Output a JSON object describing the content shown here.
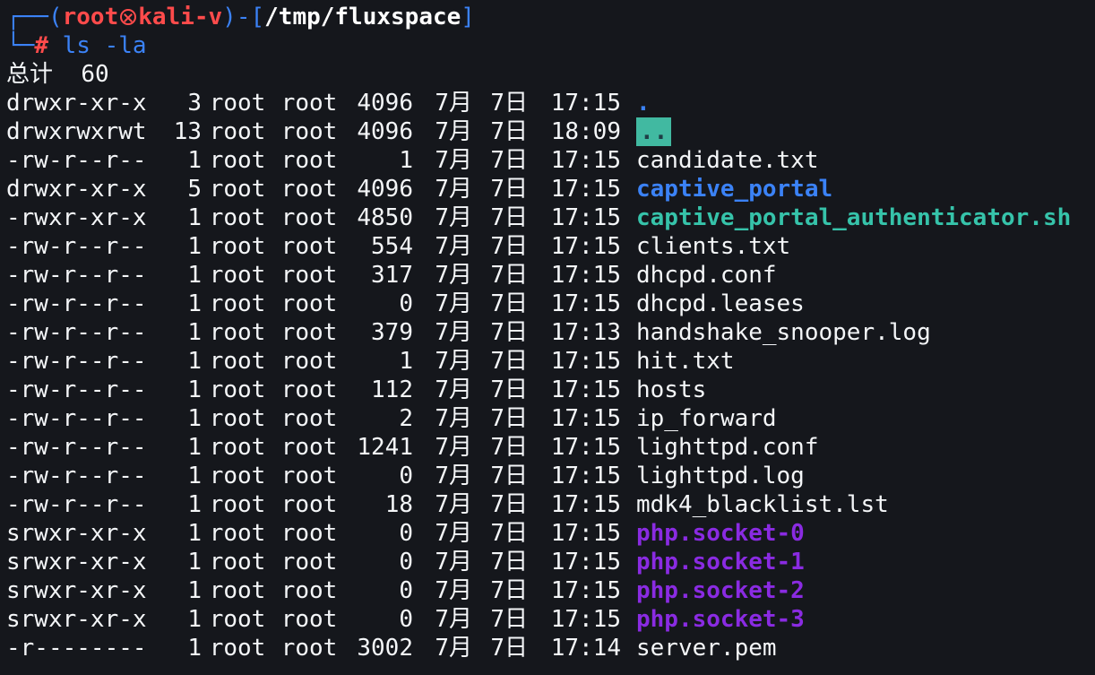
{
  "prompt": {
    "open": "┌──(",
    "user": "root",
    "host": "kali-v",
    "mid": ")-[",
    "path": "/tmp/fluxspace",
    "close": "]",
    "second_prefix": "└─",
    "hash": "#",
    "command": "ls -la"
  },
  "total": {
    "label": "总计",
    "value": "60"
  },
  "entries": [
    {
      "perm": "drwxr-xr-x",
      "links": "3",
      "owner": "root",
      "group": "root",
      "size": "4096",
      "month": "7月",
      "day": "7日",
      "time": "17:15",
      "name": "."
    },
    {
      "perm": "drwxrwxrwt",
      "links": "13",
      "owner": "root",
      "group": "root",
      "size": "4096",
      "month": "7月",
      "day": "7日",
      "time": "18:09",
      "name": ".."
    },
    {
      "perm": "-rw-r--r--",
      "links": "1",
      "owner": "root",
      "group": "root",
      "size": "1",
      "month": "7月",
      "day": "7日",
      "time": "17:15",
      "name": "candidate.txt"
    },
    {
      "perm": "drwxr-xr-x",
      "links": "5",
      "owner": "root",
      "group": "root",
      "size": "4096",
      "month": "7月",
      "day": "7日",
      "time": "17:15",
      "name": "captive_portal"
    },
    {
      "perm": "-rwxr-xr-x",
      "links": "1",
      "owner": "root",
      "group": "root",
      "size": "4850",
      "month": "7月",
      "day": "7日",
      "time": "17:15",
      "name": "captive_portal_authenticator.sh"
    },
    {
      "perm": "-rw-r--r--",
      "links": "1",
      "owner": "root",
      "group": "root",
      "size": "554",
      "month": "7月",
      "day": "7日",
      "time": "17:15",
      "name": "clients.txt"
    },
    {
      "perm": "-rw-r--r--",
      "links": "1",
      "owner": "root",
      "group": "root",
      "size": "317",
      "month": "7月",
      "day": "7日",
      "time": "17:15",
      "name": "dhcpd.conf"
    },
    {
      "perm": "-rw-r--r--",
      "links": "1",
      "owner": "root",
      "group": "root",
      "size": "0",
      "month": "7月",
      "day": "7日",
      "time": "17:15",
      "name": "dhcpd.leases"
    },
    {
      "perm": "-rw-r--r--",
      "links": "1",
      "owner": "root",
      "group": "root",
      "size": "379",
      "month": "7月",
      "day": "7日",
      "time": "17:13",
      "name": "handshake_snooper.log"
    },
    {
      "perm": "-rw-r--r--",
      "links": "1",
      "owner": "root",
      "group": "root",
      "size": "1",
      "month": "7月",
      "day": "7日",
      "time": "17:15",
      "name": "hit.txt"
    },
    {
      "perm": "-rw-r--r--",
      "links": "1",
      "owner": "root",
      "group": "root",
      "size": "112",
      "month": "7月",
      "day": "7日",
      "time": "17:15",
      "name": "hosts"
    },
    {
      "perm": "-rw-r--r--",
      "links": "1",
      "owner": "root",
      "group": "root",
      "size": "2",
      "month": "7月",
      "day": "7日",
      "time": "17:15",
      "name": "ip_forward"
    },
    {
      "perm": "-rw-r--r--",
      "links": "1",
      "owner": "root",
      "group": "root",
      "size": "1241",
      "month": "7月",
      "day": "7日",
      "time": "17:15",
      "name": "lighttpd.conf"
    },
    {
      "perm": "-rw-r--r--",
      "links": "1",
      "owner": "root",
      "group": "root",
      "size": "0",
      "month": "7月",
      "day": "7日",
      "time": "17:15",
      "name": "lighttpd.log"
    },
    {
      "perm": "-rw-r--r--",
      "links": "1",
      "owner": "root",
      "group": "root",
      "size": "18",
      "month": "7月",
      "day": "7日",
      "time": "17:15",
      "name": "mdk4_blacklist.lst"
    },
    {
      "perm": "srwxr-xr-x",
      "links": "1",
      "owner": "root",
      "group": "root",
      "size": "0",
      "month": "7月",
      "day": "7日",
      "time": "17:15",
      "name": "php.socket-0"
    },
    {
      "perm": "srwxr-xr-x",
      "links": "1",
      "owner": "root",
      "group": "root",
      "size": "0",
      "month": "7月",
      "day": "7日",
      "time": "17:15",
      "name": "php.socket-1"
    },
    {
      "perm": "srwxr-xr-x",
      "links": "1",
      "owner": "root",
      "group": "root",
      "size": "0",
      "month": "7月",
      "day": "7日",
      "time": "17:15",
      "name": "php.socket-2"
    },
    {
      "perm": "srwxr-xr-x",
      "links": "1",
      "owner": "root",
      "group": "root",
      "size": "0",
      "month": "7月",
      "day": "7日",
      "time": "17:15",
      "name": "php.socket-3"
    },
    {
      "perm": "-r--------",
      "links": "1",
      "owner": "root",
      "group": "root",
      "size": "3002",
      "month": "7月",
      "day": "7日",
      "time": "17:14",
      "name": "server.pem"
    }
  ],
  "colors": {
    "background": "#15171c",
    "text": "#f4f6f8",
    "prompt_blue": "#3b82f6",
    "prompt_red": "#ff4b4b",
    "directory": "#3b82f6",
    "executable": "#36c3aa",
    "socket": "#8a2be2",
    "dotdot_bg": "#41b9a1"
  }
}
